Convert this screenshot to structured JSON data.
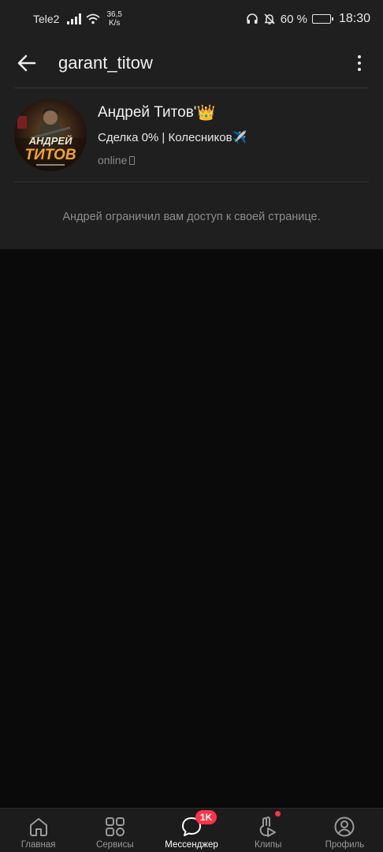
{
  "status_bar": {
    "carrier": "Tele2",
    "net_speed_value": "36,5",
    "net_speed_unit": "K/s",
    "battery_percent": "60 %",
    "battery_level": 0.6,
    "time": "18:30",
    "icons": [
      "signal-icon",
      "wifi-icon",
      "headphones-icon",
      "bell-off-icon",
      "battery-icon"
    ]
  },
  "header": {
    "title": "garant_titow",
    "back_icon": "arrow-left-icon",
    "more_icon": "more-vertical-icon"
  },
  "profile": {
    "avatar_text_top": "АНДРЕЙ",
    "avatar_text_bottom": "ТИТОВ",
    "name": "Андрей Титов'",
    "name_emoji": "👑",
    "status": "Сделка 0% | Колесников",
    "status_emoji": "✈️",
    "online": "online",
    "online_icon": "phone-icon"
  },
  "restricted_message": "Андрей ограничил вам доступ к своей странице.",
  "bottom_nav": {
    "items": [
      {
        "label": "Главная",
        "icon": "home-icon"
      },
      {
        "label": "Сервисы",
        "icon": "services-icon"
      },
      {
        "label": "Мессенджер",
        "icon": "messenger-icon",
        "active": true,
        "badge": "1K"
      },
      {
        "label": "Клипы",
        "icon": "clips-icon",
        "dot": true
      },
      {
        "label": "Профиль",
        "icon": "profile-icon"
      }
    ]
  },
  "colors": {
    "background": "#0a0a0a",
    "surface": "#1f1f1f",
    "badge": "#ff3347",
    "muted_text": "#8c8c8c"
  }
}
